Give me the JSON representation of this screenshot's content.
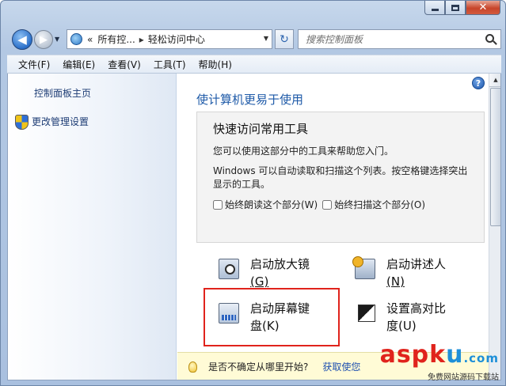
{
  "window": {
    "caption_buttons": [
      "minimize-icon",
      "maximize-icon",
      "close-icon"
    ]
  },
  "nav": {
    "back_icon": "back-arrow-icon",
    "forward_icon": "forward-arrow-icon",
    "breadcrumb_prefix": "«",
    "breadcrumb_parent": "所有控...",
    "breadcrumb_separator": "▸",
    "breadcrumb_current": "轻松访问中心",
    "refresh_glyph": "↻",
    "search_placeholder": "搜索控制面板"
  },
  "menu": {
    "items": [
      "文件(F)",
      "编辑(E)",
      "查看(V)",
      "工具(T)",
      "帮助(H)"
    ]
  },
  "sidebar": {
    "home_link": "控制面板主页",
    "admin_link": "更改管理设置"
  },
  "main": {
    "help_glyph": "?",
    "section_title": "使计算机更易于使用",
    "quick_access": {
      "title": "快速访问常用工具",
      "line1": "您可以使用这部分中的工具来帮助您入门。",
      "line2": "Windows 可以自动读取和扫描这个列表。按空格键选择突出显示的工具。",
      "check_read": "始终朗读这个部分(W)",
      "check_scan": "始终扫描这个部分(O)"
    },
    "tools": [
      {
        "label1": "启动放大镜",
        "label2": "(G)"
      },
      {
        "label1": "启动讲述人",
        "label2": "(N)"
      },
      {
        "label1": "启动屏幕键",
        "label2": "盘(K)"
      },
      {
        "label1": "设置高对比",
        "label2": "度(U)"
      }
    ],
    "tip": {
      "text": "是否不确定从哪里开始?",
      "link": "获取使您"
    }
  },
  "watermark": {
    "main_a": "asp",
    "main_k": "k",
    "main_u": "u",
    "dot": ".com",
    "sub": "免费网站源码下载站"
  },
  "colors": {
    "accent_link": "#1e5aa8",
    "highlight_box": "#e0231c",
    "tip_background": "#fffbd6"
  }
}
